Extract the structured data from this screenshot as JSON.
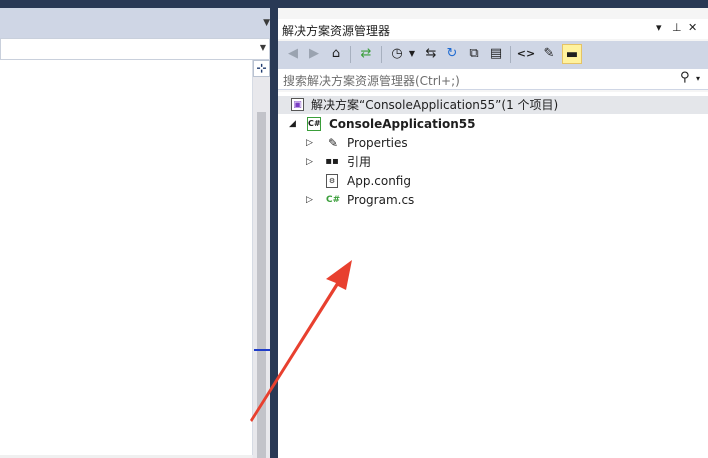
{
  "solution_explorer": {
    "title": "解决方案资源管理器",
    "title_controls": {
      "dropdown": "▾",
      "pin": "⊥",
      "close": "✕"
    },
    "toolbar": {
      "back": "◀",
      "forward": "▶",
      "home": "⌂",
      "sync": "⇄",
      "history": "◷",
      "pending_changes": "⇆",
      "refresh": "↻",
      "collapse_all": "⧉",
      "show_all_files": "▤",
      "view_code": "<>",
      "properties": "✎",
      "preview": "▬"
    },
    "search": {
      "placeholder": "搜索解决方案资源管理器(Ctrl+;)",
      "search_icon": "⚲",
      "dropdown": "▾"
    },
    "tree": {
      "solution": "解决方案“ConsoleApplication55”(1 个项目)",
      "project": "ConsoleApplication55",
      "items": [
        {
          "label": "Properties",
          "icon": "wrench-icon"
        },
        {
          "label": "引用",
          "icon": "references-icon"
        },
        {
          "label": "App.config",
          "icon": "config-file-icon"
        },
        {
          "label": "Program.cs",
          "icon": "csharp-file-icon"
        }
      ]
    }
  },
  "editor": {
    "split_glyph": "⊹"
  },
  "colors": {
    "chrome_dark": "#293955",
    "toolbar": "#cfd6e5",
    "arrow": "#e8402f",
    "highlight": "#fff29d"
  }
}
